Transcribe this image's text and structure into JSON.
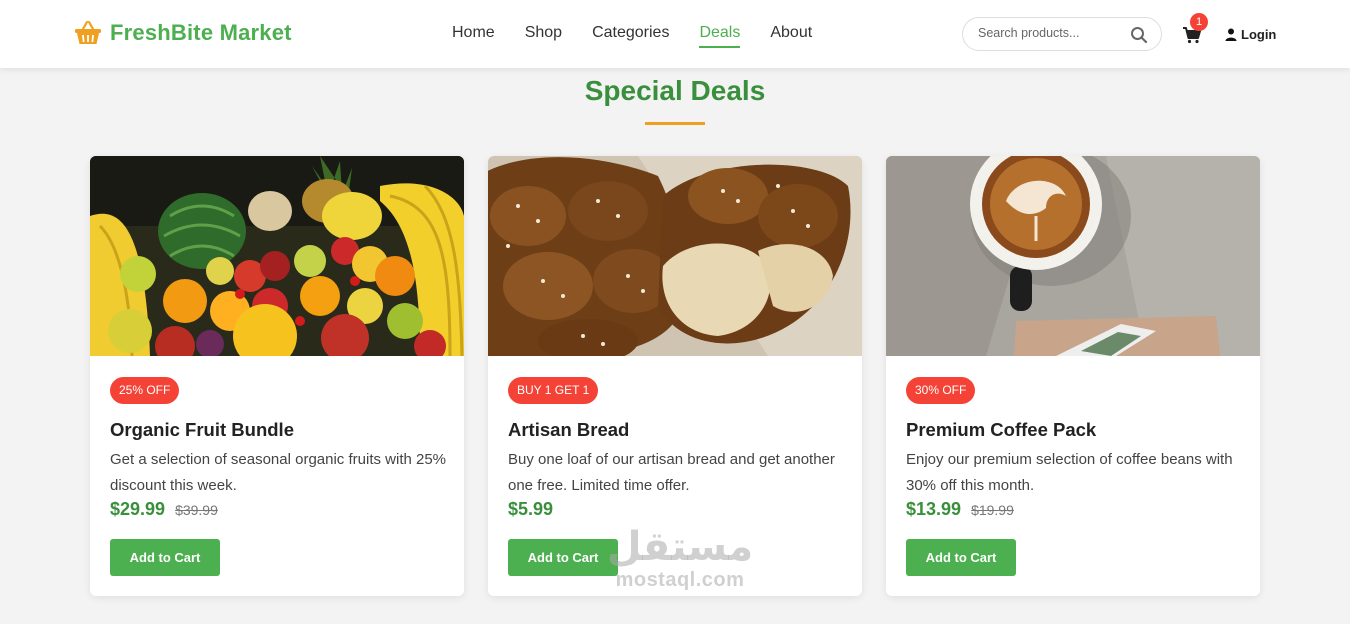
{
  "header": {
    "brand": "FreshBite Market",
    "nav": [
      {
        "label": "Home",
        "active": false
      },
      {
        "label": "Shop",
        "active": false
      },
      {
        "label": "Categories",
        "active": false
      },
      {
        "label": "Deals",
        "active": true
      },
      {
        "label": "About",
        "active": false
      }
    ],
    "search_placeholder": "Search products...",
    "cart_count": "1",
    "login_label": "Login"
  },
  "section": {
    "title": "Special Deals"
  },
  "cards": [
    {
      "image": "fruit-assortment-photo",
      "badge": "25% OFF",
      "title": "Organic Fruit Bundle",
      "description": "Get a selection of seasonal organic fruits with 25% discount this week.",
      "price": "$29.99",
      "old_price": "$39.99",
      "button": "Add to Cart"
    },
    {
      "image": "braided-bread-photo",
      "badge": "BUY 1 GET 1",
      "title": "Artisan Bread",
      "description": "Buy one loaf of our artisan bread and get another one free. Limited time offer.",
      "price": "$5.99",
      "old_price": "",
      "button": "Add to Cart"
    },
    {
      "image": "coffee-cup-photo",
      "badge": "30% OFF",
      "title": "Premium Coffee Pack",
      "description": "Enjoy our premium selection of coffee beans with 30% off this month.",
      "price": "$13.99",
      "old_price": "$19.99",
      "button": "Add to Cart"
    }
  ],
  "watermark": {
    "arabic": "مستقل",
    "latin": "mostaql.com"
  },
  "colors": {
    "brand": "#4caf50",
    "title": "#3a8f3c",
    "accent": "#f0a020",
    "badge": "#f44336"
  }
}
